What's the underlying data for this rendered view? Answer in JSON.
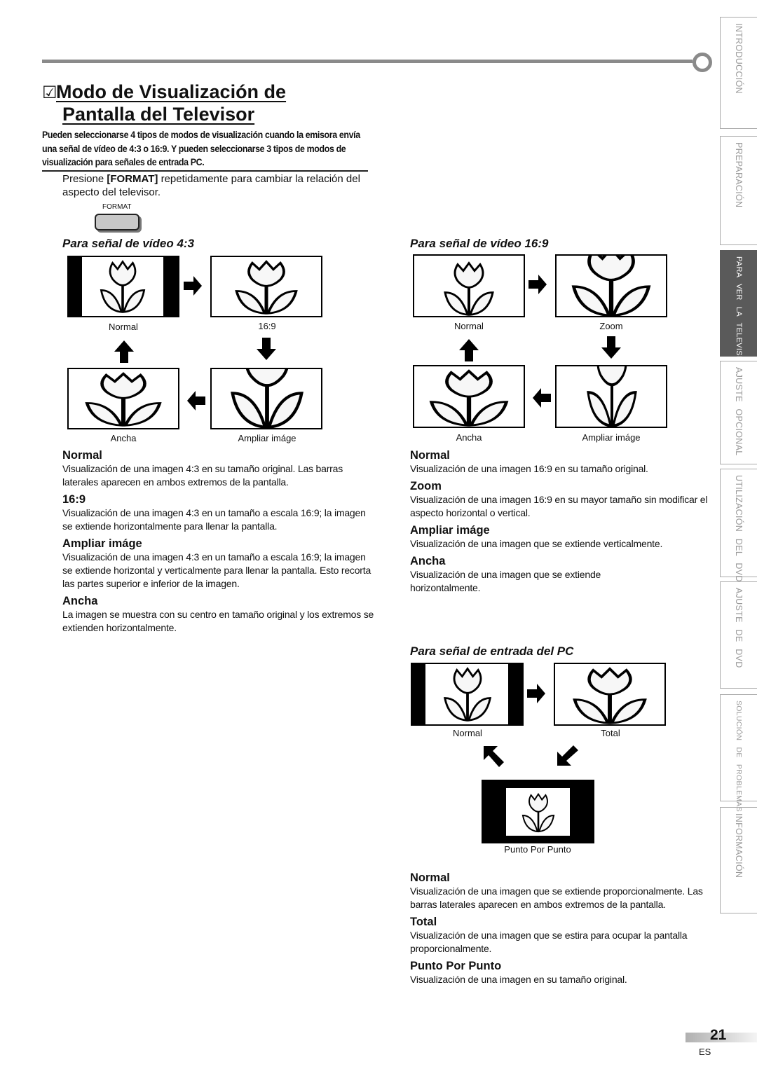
{
  "title": {
    "line1": "Modo de Visualización de",
    "line2": "Pantalla del Televisor",
    "check_icon": "checkbox-checked-icon"
  },
  "intro": "Pueden seleccionarse 4 tipos de modos de visualización cuando la emisora envía una señal de vídeo de 4:3 o 16:9. Y pueden seleccionarse 3 tipos de modos de visualización para señales de entrada PC.",
  "instruction": {
    "prefix": "Presione ",
    "key": "[FORMAT]",
    "suffix": " repetidamente para cambiar la relación del aspecto del televisor."
  },
  "format_button": {
    "label": "FORMAT"
  },
  "sections": {
    "video43": {
      "heading": "Para señal de vídeo 4:3",
      "captions": {
        "normal": "Normal",
        "r169": "16:9",
        "ancha": "Ancha",
        "ampliar": "Ampliar imáge"
      },
      "items": [
        {
          "title": "Normal",
          "text": "Visualización de una imagen 4:3 en su tamaño original. Las barras laterales aparecen en ambos extremos de la pantalla."
        },
        {
          "title": "16:9",
          "text": "Visualización de una imagen 4:3 en un tamaño a escala 16:9; la imagen se extiende horizontalmente para llenar la pantalla."
        },
        {
          "title": "Ampliar imáge",
          "text": "Visualización de una imagen 4:3 en un tamaño a escala 16:9; la imagen se extiende horizontal y verticalmente para llenar la pantalla. Esto recorta las partes superior e inferior de la imagen."
        },
        {
          "title": "Ancha",
          "text": "La imagen se muestra con su centro en tamaño original y los extremos se extienden horizontalmente."
        }
      ]
    },
    "video169": {
      "heading": "Para señal de vídeo 16:9",
      "captions": {
        "normal": "Normal",
        "zoom": "Zoom",
        "ancha": "Ancha",
        "ampliar": "Ampliar imáge"
      },
      "items": [
        {
          "title": "Normal",
          "text": "Visualización de una imagen 16:9 en su tamaño original."
        },
        {
          "title": "Zoom",
          "text": "Visualización de una imagen 16:9 en su mayor tamaño sin modificar el aspecto horizontal o vertical."
        },
        {
          "title": "Ampliar imáge",
          "text": "Visualización de una imagen que se extiende verticalmente."
        },
        {
          "title": "Ancha",
          "text": "Visualización de una imagen que se extiende horizontalmente."
        }
      ]
    },
    "pc": {
      "heading": "Para señal de entrada del PC",
      "captions": {
        "normal": "Normal",
        "total": "Total",
        "punto": "Punto Por Punto"
      },
      "items": [
        {
          "title": "Normal",
          "text": "Visualización de una imagen que se extiende proporcionalmente. Las barras laterales aparecen en ambos extremos de la pantalla."
        },
        {
          "title": "Total",
          "text": "Visualización de una imagen que se estira para ocupar la pantalla proporcionalmente."
        },
        {
          "title": "Punto Por Punto",
          "text": "Visualización de una imagen en su tamaño original."
        }
      ]
    }
  },
  "side_tabs": [
    {
      "label": "INTRODUCCIÓN",
      "active": false
    },
    {
      "label": "PREPARACIÓN",
      "active": false
    },
    {
      "label": "PARA VER LA TELEVISIÓN",
      "active": true
    },
    {
      "label": "AJUSTE OPCIONAL",
      "active": false
    },
    {
      "label": "UTILIZACIÓN DEL DVD",
      "active": false
    },
    {
      "label": "AJUSTE DE DVD",
      "active": false
    },
    {
      "label": "SOLUCIÓN DE PROBLEMAS",
      "active": false
    },
    {
      "label": "INFORMACIÓN",
      "active": false
    }
  ],
  "footer": {
    "page_number": "21",
    "language": "ES"
  }
}
